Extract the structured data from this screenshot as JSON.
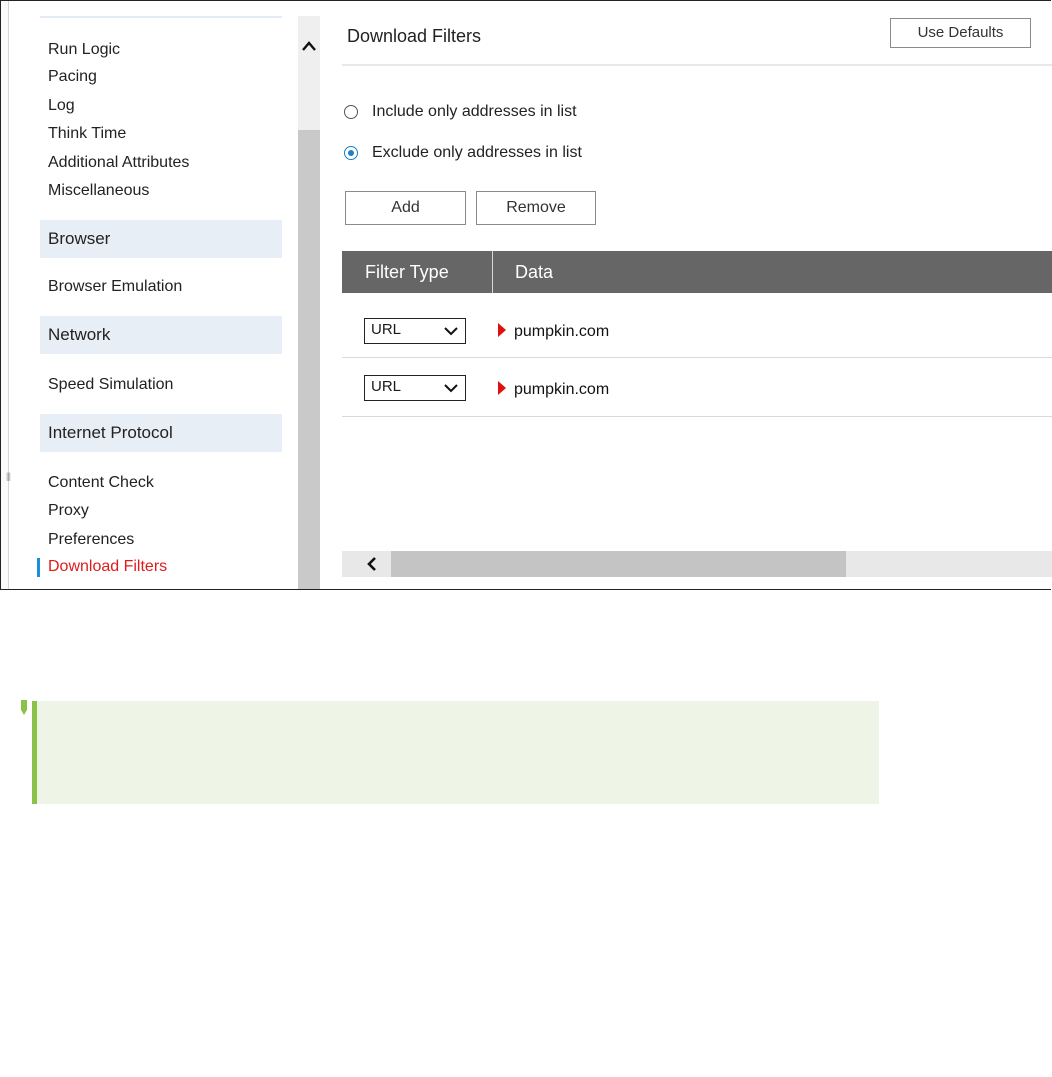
{
  "sidebar": {
    "items_top": [
      {
        "label": "Run Logic"
      },
      {
        "label": "Pacing"
      },
      {
        "label": "Log"
      },
      {
        "label": "Think Time"
      },
      {
        "label": "Additional Attributes"
      },
      {
        "label": "Miscellaneous"
      }
    ],
    "sections": [
      {
        "header": "Browser",
        "items": [
          {
            "label": "Browser Emulation"
          }
        ]
      },
      {
        "header": "Network",
        "items": [
          {
            "label": "Speed Simulation"
          }
        ]
      },
      {
        "header": "Internet Protocol",
        "items": [
          {
            "label": "Content Check"
          },
          {
            "label": "Proxy"
          },
          {
            "label": "Preferences"
          },
          {
            "label": "Download Filters",
            "active": true
          }
        ]
      }
    ]
  },
  "panel": {
    "title": "Download Filters",
    "use_defaults_label": "Use Defaults",
    "radio_options": [
      {
        "label": "Include only addresses in list",
        "checked": false
      },
      {
        "label": "Exclude only addresses in list",
        "checked": true
      }
    ],
    "add_label": "Add",
    "remove_label": "Remove",
    "table": {
      "columns": [
        "Filter Type",
        "Data"
      ],
      "rows": [
        {
          "filter_type": "URL",
          "data": "pumpkin.com"
        },
        {
          "filter_type": "URL",
          "data": "pumpkin.com"
        }
      ]
    }
  },
  "colors": {
    "active_nav": "#e01b1b",
    "active_indicator": "#1c8fd9",
    "section_bg": "#e8eef6",
    "table_header_bg": "#666666",
    "radio_accent": "#1c7fc7",
    "note_bg": "#eef4e6",
    "note_accent": "#8bc34a",
    "row_marker": "#e01010"
  },
  "icons": {
    "scroll_up": "chevron-up-icon",
    "scroll_left": "chevron-left-icon",
    "select_arrow": "chevron-down-icon",
    "row_marker": "caret-right-icon",
    "note": "note-icon"
  }
}
